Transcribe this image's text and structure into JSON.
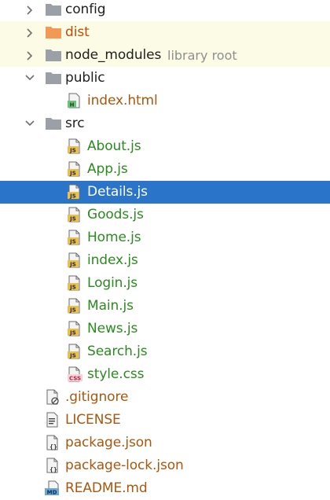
{
  "colors": {
    "folder_text": "#1e1e1e",
    "git_ignored": "#a7570e",
    "git_added": "#2b8a1f",
    "excluded": "#b84e07",
    "library_hint": "#8f8f8f",
    "selection_bg": "#2a75c9",
    "selection_text": "#ffffff",
    "row_tint": "#fcfbe6"
  },
  "tree": [
    {
      "label": "config",
      "kind": "folder",
      "chevron": "right",
      "level": 0,
      "icon": "folder-gray-icon",
      "color": "#1e1e1e",
      "tint": false
    },
    {
      "label": "dist",
      "kind": "folder",
      "chevron": "right",
      "level": 0,
      "icon": "folder-orange-icon",
      "color": "#b84e07",
      "tint": true
    },
    {
      "label": "node_modules",
      "hint": "library root",
      "kind": "folder",
      "chevron": "right",
      "level": 0,
      "icon": "folder-gray-icon",
      "color": "#1e1e1e",
      "tint": true
    },
    {
      "label": "public",
      "kind": "folder",
      "chevron": "down",
      "level": 0,
      "icon": "folder-gray-icon",
      "color": "#1e1e1e",
      "tint": false
    },
    {
      "label": "index.html",
      "kind": "file",
      "level": 1,
      "icon": "html-file-icon",
      "color": "#a7570e",
      "tint": false
    },
    {
      "label": "src",
      "kind": "folder",
      "chevron": "down",
      "level": 0,
      "icon": "folder-gray-icon",
      "color": "#1e1e1e",
      "tint": false
    },
    {
      "label": "About.js",
      "kind": "file",
      "level": 1,
      "icon": "js-file-icon",
      "color": "#2b8a1f",
      "tint": false
    },
    {
      "label": "App.js",
      "kind": "file",
      "level": 1,
      "icon": "js-file-icon",
      "color": "#2b8a1f",
      "tint": false
    },
    {
      "label": "Details.js",
      "kind": "file",
      "level": 1,
      "icon": "js-file-icon",
      "color": "#ffffff",
      "tint": false,
      "selected": true
    },
    {
      "label": "Goods.js",
      "kind": "file",
      "level": 1,
      "icon": "js-file-icon",
      "color": "#2b8a1f",
      "tint": false
    },
    {
      "label": "Home.js",
      "kind": "file",
      "level": 1,
      "icon": "js-file-icon",
      "color": "#2b8a1f",
      "tint": false
    },
    {
      "label": "index.js",
      "kind": "file",
      "level": 1,
      "icon": "js-file-icon",
      "color": "#2b8a1f",
      "tint": false
    },
    {
      "label": "Login.js",
      "kind": "file",
      "level": 1,
      "icon": "js-file-icon",
      "color": "#2b8a1f",
      "tint": false
    },
    {
      "label": "Main.js",
      "kind": "file",
      "level": 1,
      "icon": "js-file-icon",
      "color": "#2b8a1f",
      "tint": false
    },
    {
      "label": "News.js",
      "kind": "file",
      "level": 1,
      "icon": "js-file-icon",
      "color": "#2b8a1f",
      "tint": false
    },
    {
      "label": "Search.js",
      "kind": "file",
      "level": 1,
      "icon": "js-file-icon",
      "color": "#2b8a1f",
      "tint": false
    },
    {
      "label": "style.css",
      "kind": "file",
      "level": 1,
      "icon": "css-file-icon",
      "color": "#2b8a1f",
      "tint": false
    },
    {
      "label": ".gitignore",
      "kind": "file",
      "level": 0,
      "icon": "gitignore-file-icon",
      "color": "#a7570e",
      "tint": false
    },
    {
      "label": "LICENSE",
      "kind": "file",
      "level": 0,
      "icon": "text-file-icon",
      "color": "#a7570e",
      "tint": false
    },
    {
      "label": "package.json",
      "kind": "file",
      "level": 0,
      "icon": "json-file-icon",
      "color": "#a7570e",
      "tint": false
    },
    {
      "label": "package-lock.json",
      "kind": "file",
      "level": 0,
      "icon": "json-file-icon",
      "color": "#a7570e",
      "tint": false
    },
    {
      "label": "README.md",
      "kind": "file",
      "level": 0,
      "icon": "markdown-file-icon",
      "color": "#a7570e",
      "tint": false
    }
  ]
}
